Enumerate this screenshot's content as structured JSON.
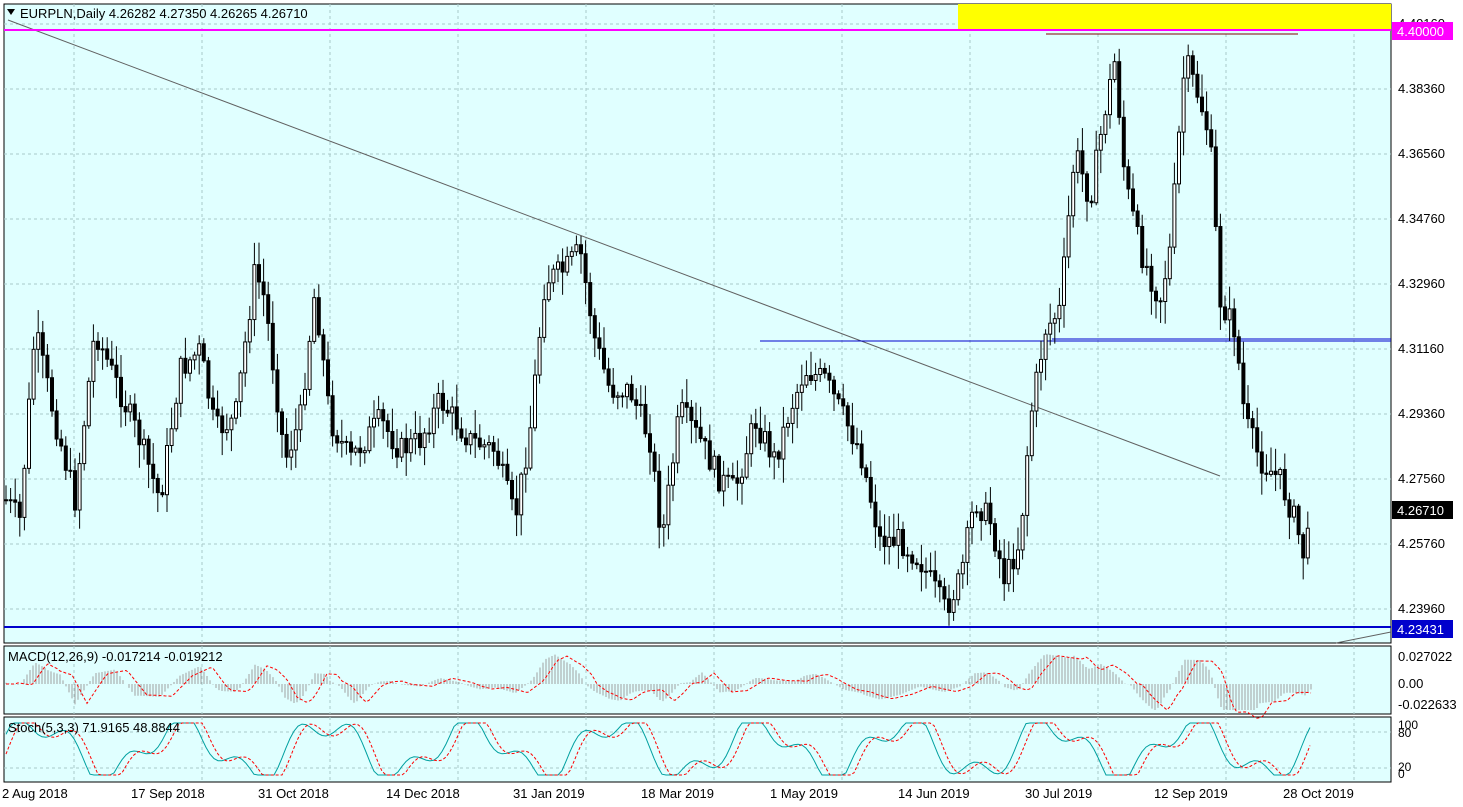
{
  "symbol_header": "EURPLN,Daily  4.26282 4.27350 4.26265 4.26710",
  "colors": {
    "background": "#e0ffff",
    "grid": "#a8c8c8",
    "candle": "#000000",
    "resistance": "#ff00ff",
    "support": "#0000cc",
    "highlight_box": "#ffff00",
    "price_label_bg": "#000000",
    "macd_signal": "#ff0000",
    "macd_hist": "#a0a0a0",
    "stoch_main": "#00a0a0",
    "stoch_signal": "#ff0000"
  },
  "price_axis": {
    "ticks": [
      "4.40160",
      "4.38360",
      "4.36560",
      "4.34760",
      "4.32960",
      "4.31160",
      "4.29360",
      "4.27560",
      "4.25760",
      "4.23960"
    ],
    "current_price": "4.26710",
    "magenta_level": "4.40000",
    "blue_level": "4.23431"
  },
  "time_axis": {
    "labels": [
      "2 Aug 2018",
      "17 Sep 2018",
      "31 Oct 2018",
      "14 Dec 2018",
      "31 Jan 2019",
      "18 Mar 2019",
      "1 May 2019",
      "14 Jun 2019",
      "30 Jul 2019",
      "12 Sep 2019",
      "28 Oct 2019"
    ]
  },
  "macd": {
    "label": "MACD(12,26,9) -0.017214 -0.019212",
    "ticks": [
      "0.027022",
      "0.00",
      "-0.022633"
    ]
  },
  "stoch": {
    "label": "Stoch(5,3,3) 71.9165 48.8844",
    "ticks": [
      "100",
      "80",
      "20",
      "0"
    ]
  }
}
